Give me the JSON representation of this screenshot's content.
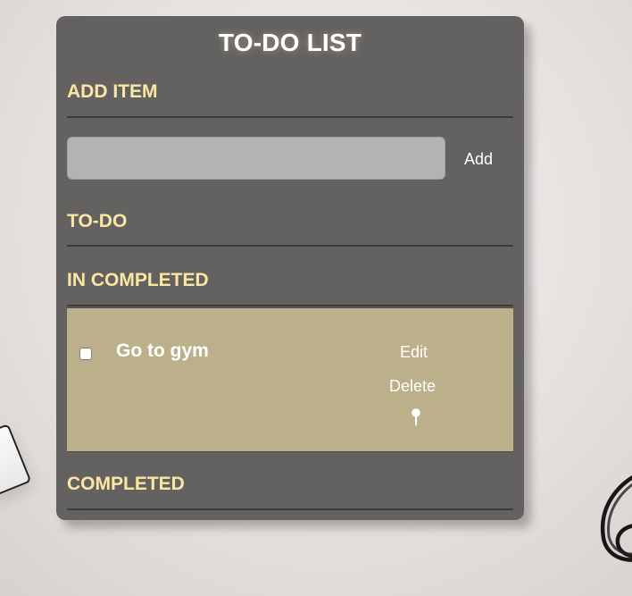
{
  "app": {
    "title": "TO-DO LIST"
  },
  "sections": {
    "add_item": "ADD ITEM",
    "todo": "TO-DO",
    "incomplete": "IN COMPLETED",
    "completed": "COMPLETED"
  },
  "add_form": {
    "input_value": "",
    "input_placeholder": "",
    "button_label": "Add"
  },
  "incomplete_items": [
    {
      "text": "Go to gym",
      "edit_label": "Edit",
      "delete_label": "Delete",
      "icon": "pin-icon"
    }
  ],
  "colors": {
    "card_bg": "#646261",
    "heading": "#fbe7a2",
    "item_bg": "#bbb08a",
    "input_bg": "#b3b3b3",
    "text": "#ffffff"
  },
  "icons": {
    "checkbox": "checkbox-icon",
    "pin": "pin-icon"
  }
}
